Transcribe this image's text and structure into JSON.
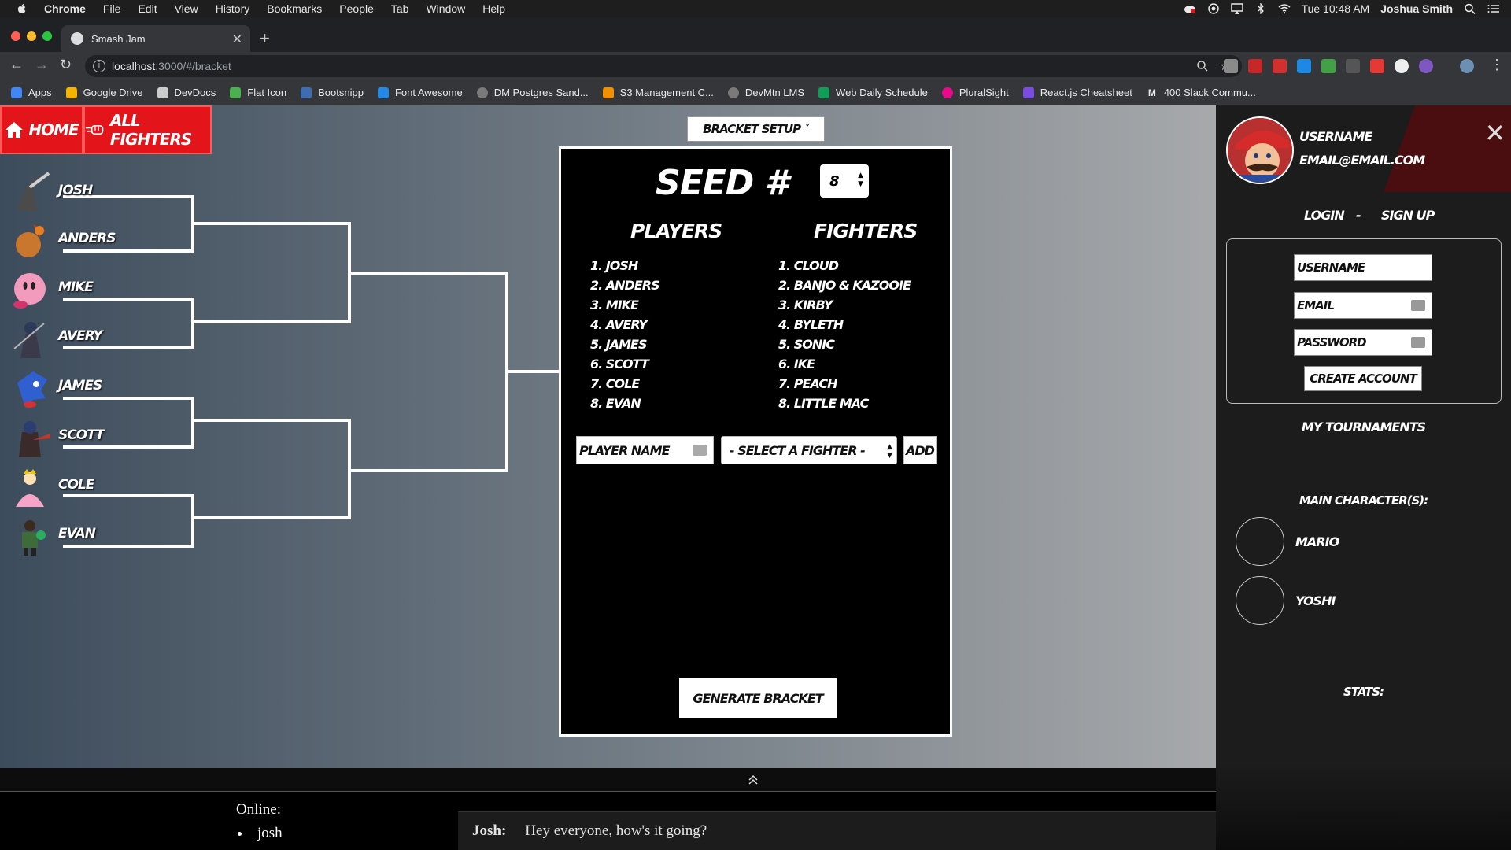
{
  "menubar": {
    "app": "Chrome",
    "items": [
      "File",
      "Edit",
      "View",
      "History",
      "Bookmarks",
      "People",
      "Tab",
      "Window",
      "Help"
    ],
    "clock": "Tue 10:48 AM",
    "user": "Joshua Smith"
  },
  "browser": {
    "tab_title": "Smash Jam",
    "url_host": "localhost",
    "url_path": ":3000/#/bracket"
  },
  "bookmarks": [
    {
      "label": "Apps",
      "color": "#e8eaed"
    },
    {
      "label": "Google Drive",
      "color": "#f4b400"
    },
    {
      "label": "DevDocs",
      "color": "#cccccc"
    },
    {
      "label": "Flat Icon",
      "color": "#4caf50"
    },
    {
      "label": "Bootsnipp",
      "color": "#3f6db3"
    },
    {
      "label": "Font Awesome",
      "color": "#228ae6"
    },
    {
      "label": "DM Postgres Sand...",
      "color": "#7a7a7a"
    },
    {
      "label": "S3 Management C...",
      "color": "#f29100"
    },
    {
      "label": "DevMtn LMS",
      "color": "#7a7a7a"
    },
    {
      "label": "Web Daily Schedule",
      "color": "#0f9d58"
    },
    {
      "label": "PluralSight",
      "color": "#e80a89"
    },
    {
      "label": "React.js Cheatsheet",
      "color": "#7b4ce0"
    },
    {
      "label": "400 Slack Commu...",
      "color": "#e8eaed"
    }
  ],
  "nav": {
    "home": "HOME",
    "all_fighters": "ALL FIGHTERS",
    "bracket_setup": "BRACKET SETUP ˅"
  },
  "bracket": {
    "players": [
      {
        "name": "JOSH",
        "fighter_color": "#4b4b4b"
      },
      {
        "name": "ANDERS",
        "fighter_color": "#c9772e"
      },
      {
        "name": "MIKE",
        "fighter_color": "#f29bbd"
      },
      {
        "name": "AVERY",
        "fighter_color": "#3a3a4a"
      },
      {
        "name": "JAMES",
        "fighter_color": "#2f5fd0"
      },
      {
        "name": "SCOTT",
        "fighter_color": "#7a2b2b"
      },
      {
        "name": "COLE",
        "fighter_color": "#f6a5c8"
      },
      {
        "name": "EVAN",
        "fighter_color": "#3d6b3a"
      }
    ]
  },
  "seed_panel": {
    "title": "SEED #",
    "seed_count": "8",
    "players_heading": "PLAYERS",
    "fighters_heading": "FIGHTERS",
    "players": [
      "1. JOSH",
      "2. ANDERS",
      "3. MIKE",
      "4. AVERY",
      "5. JAMES",
      "6. SCOTT",
      "7. COLE",
      "8. EVAN"
    ],
    "fighters": [
      "1. CLOUD",
      "2. BANJO & KAZOOIE",
      "3. KIRBY",
      "4. BYLETH",
      "5. SONIC",
      "6. IKE",
      "7. PEACH",
      "8. LITTLE MAC"
    ],
    "player_name_value": "PLAYER NAME",
    "fighter_select_value": "- SELECT A FIGHTER -",
    "add_label": "ADD",
    "generate_label": "GENERATE BRACKET"
  },
  "sidebar": {
    "username": "USERNAME",
    "email": "EMAIL@EMAIL.COM",
    "close": "✕",
    "login": "LOGIN",
    "dash": "-",
    "signup": "SIGN UP",
    "form": {
      "username_value": "USERNAME",
      "email_value": "EMAIL",
      "password_value": "PASSWORD",
      "create_account": "CREATE ACCOUNT"
    },
    "my_tournaments": "MY TOURNAMENTS",
    "main_characters_label": "MAIN CHARACTER(S):",
    "main_characters": [
      "MARIO",
      "YOSHI"
    ],
    "stats_label": "STATS:"
  },
  "chat": {
    "online_title": "Online:",
    "online_users": [
      "josh"
    ],
    "message_author": "Josh:",
    "message_text": "Hey everyone, how's it going?"
  },
  "colors": {
    "brand_red": "#e4141b",
    "panel_black": "#000000",
    "sidebar_bg": "#1c1c1c"
  }
}
